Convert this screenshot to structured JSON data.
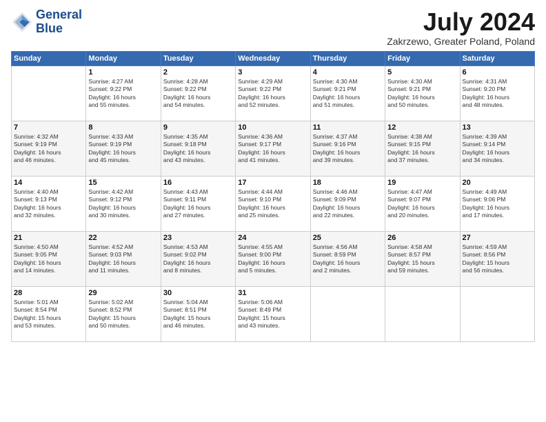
{
  "logo": {
    "line1": "General",
    "line2": "Blue"
  },
  "title": "July 2024",
  "subtitle": "Zakrzewo, Greater Poland, Poland",
  "days_header": [
    "Sunday",
    "Monday",
    "Tuesday",
    "Wednesday",
    "Thursday",
    "Friday",
    "Saturday"
  ],
  "weeks": [
    [
      {
        "num": "",
        "text": ""
      },
      {
        "num": "1",
        "text": "Sunrise: 4:27 AM\nSunset: 9:22 PM\nDaylight: 16 hours\nand 55 minutes."
      },
      {
        "num": "2",
        "text": "Sunrise: 4:28 AM\nSunset: 9:22 PM\nDaylight: 16 hours\nand 54 minutes."
      },
      {
        "num": "3",
        "text": "Sunrise: 4:29 AM\nSunset: 9:22 PM\nDaylight: 16 hours\nand 52 minutes."
      },
      {
        "num": "4",
        "text": "Sunrise: 4:30 AM\nSunset: 9:21 PM\nDaylight: 16 hours\nand 51 minutes."
      },
      {
        "num": "5",
        "text": "Sunrise: 4:30 AM\nSunset: 9:21 PM\nDaylight: 16 hours\nand 50 minutes."
      },
      {
        "num": "6",
        "text": "Sunrise: 4:31 AM\nSunset: 9:20 PM\nDaylight: 16 hours\nand 48 minutes."
      }
    ],
    [
      {
        "num": "7",
        "text": "Sunrise: 4:32 AM\nSunset: 9:19 PM\nDaylight: 16 hours\nand 46 minutes."
      },
      {
        "num": "8",
        "text": "Sunrise: 4:33 AM\nSunset: 9:19 PM\nDaylight: 16 hours\nand 45 minutes."
      },
      {
        "num": "9",
        "text": "Sunrise: 4:35 AM\nSunset: 9:18 PM\nDaylight: 16 hours\nand 43 minutes."
      },
      {
        "num": "10",
        "text": "Sunrise: 4:36 AM\nSunset: 9:17 PM\nDaylight: 16 hours\nand 41 minutes."
      },
      {
        "num": "11",
        "text": "Sunrise: 4:37 AM\nSunset: 9:16 PM\nDaylight: 16 hours\nand 39 minutes."
      },
      {
        "num": "12",
        "text": "Sunrise: 4:38 AM\nSunset: 9:15 PM\nDaylight: 16 hours\nand 37 minutes."
      },
      {
        "num": "13",
        "text": "Sunrise: 4:39 AM\nSunset: 9:14 PM\nDaylight: 16 hours\nand 34 minutes."
      }
    ],
    [
      {
        "num": "14",
        "text": "Sunrise: 4:40 AM\nSunset: 9:13 PM\nDaylight: 16 hours\nand 32 minutes."
      },
      {
        "num": "15",
        "text": "Sunrise: 4:42 AM\nSunset: 9:12 PM\nDaylight: 16 hours\nand 30 minutes."
      },
      {
        "num": "16",
        "text": "Sunrise: 4:43 AM\nSunset: 9:11 PM\nDaylight: 16 hours\nand 27 minutes."
      },
      {
        "num": "17",
        "text": "Sunrise: 4:44 AM\nSunset: 9:10 PM\nDaylight: 16 hours\nand 25 minutes."
      },
      {
        "num": "18",
        "text": "Sunrise: 4:46 AM\nSunset: 9:09 PM\nDaylight: 16 hours\nand 22 minutes."
      },
      {
        "num": "19",
        "text": "Sunrise: 4:47 AM\nSunset: 9:07 PM\nDaylight: 16 hours\nand 20 minutes."
      },
      {
        "num": "20",
        "text": "Sunrise: 4:49 AM\nSunset: 9:06 PM\nDaylight: 16 hours\nand 17 minutes."
      }
    ],
    [
      {
        "num": "21",
        "text": "Sunrise: 4:50 AM\nSunset: 9:05 PM\nDaylight: 16 hours\nand 14 minutes."
      },
      {
        "num": "22",
        "text": "Sunrise: 4:52 AM\nSunset: 9:03 PM\nDaylight: 16 hours\nand 11 minutes."
      },
      {
        "num": "23",
        "text": "Sunrise: 4:53 AM\nSunset: 9:02 PM\nDaylight: 16 hours\nand 8 minutes."
      },
      {
        "num": "24",
        "text": "Sunrise: 4:55 AM\nSunset: 9:00 PM\nDaylight: 16 hours\nand 5 minutes."
      },
      {
        "num": "25",
        "text": "Sunrise: 4:56 AM\nSunset: 8:59 PM\nDaylight: 16 hours\nand 2 minutes."
      },
      {
        "num": "26",
        "text": "Sunrise: 4:58 AM\nSunset: 8:57 PM\nDaylight: 15 hours\nand 59 minutes."
      },
      {
        "num": "27",
        "text": "Sunrise: 4:59 AM\nSunset: 8:56 PM\nDaylight: 15 hours\nand 56 minutes."
      }
    ],
    [
      {
        "num": "28",
        "text": "Sunrise: 5:01 AM\nSunset: 8:54 PM\nDaylight: 15 hours\nand 53 minutes."
      },
      {
        "num": "29",
        "text": "Sunrise: 5:02 AM\nSunset: 8:52 PM\nDaylight: 15 hours\nand 50 minutes."
      },
      {
        "num": "30",
        "text": "Sunrise: 5:04 AM\nSunset: 8:51 PM\nDaylight: 15 hours\nand 46 minutes."
      },
      {
        "num": "31",
        "text": "Sunrise: 5:06 AM\nSunset: 8:49 PM\nDaylight: 15 hours\nand 43 minutes."
      },
      {
        "num": "",
        "text": ""
      },
      {
        "num": "",
        "text": ""
      },
      {
        "num": "",
        "text": ""
      }
    ]
  ]
}
